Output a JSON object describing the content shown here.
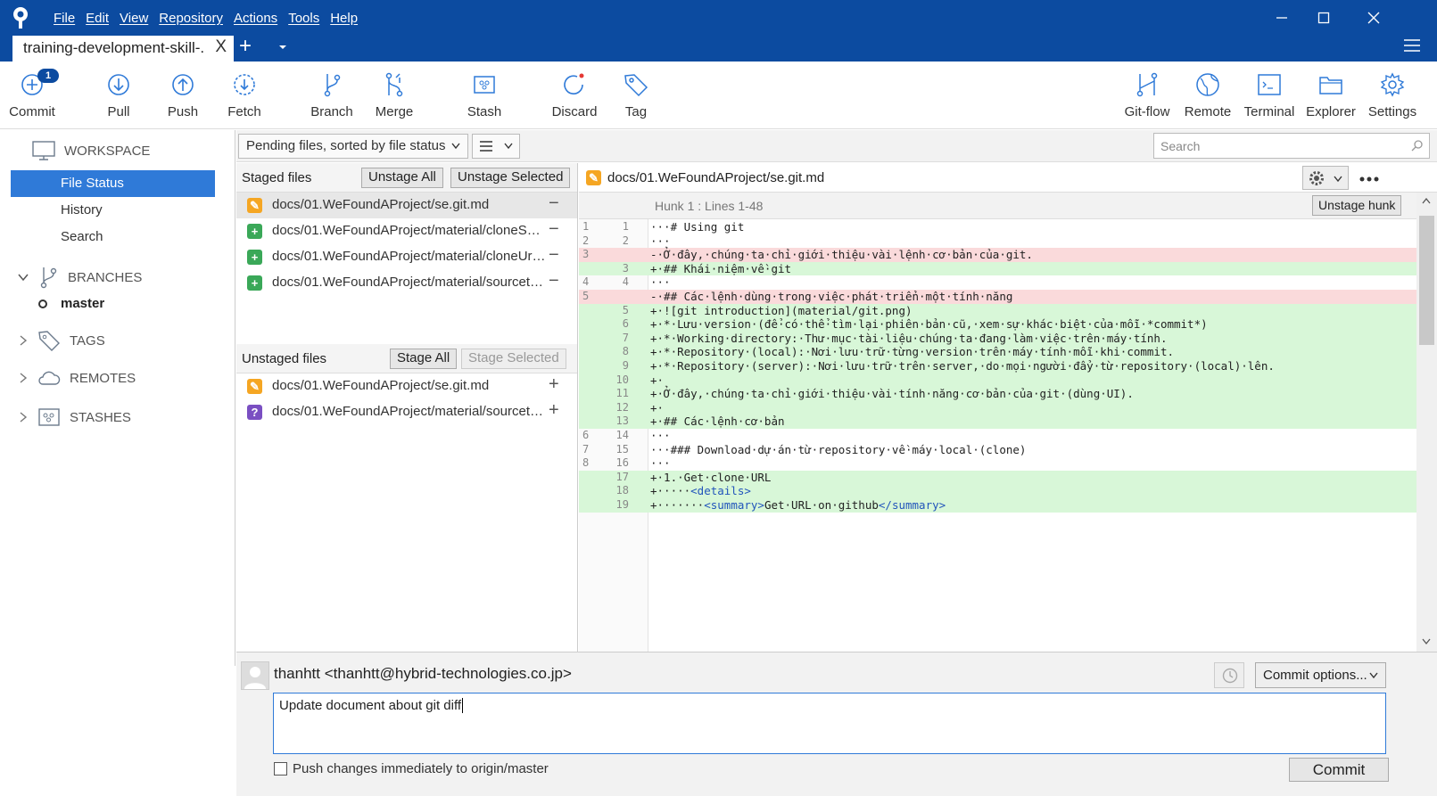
{
  "menu": [
    "File",
    "Edit",
    "View",
    "Repository",
    "Actions",
    "Tools",
    "Help"
  ],
  "tab": {
    "title": "training-development-skill-.",
    "close": "X"
  },
  "toolbar": {
    "commit": "Commit",
    "commit_badge": "1",
    "pull": "Pull",
    "push": "Push",
    "fetch": "Fetch",
    "branch": "Branch",
    "merge": "Merge",
    "stash": "Stash",
    "discard": "Discard",
    "tag": "Tag",
    "gitflow": "Git-flow",
    "remote": "Remote",
    "terminal": "Terminal",
    "explorer": "Explorer",
    "settings": "Settings"
  },
  "sidebar": {
    "workspace": "WORKSPACE",
    "file_status": "File Status",
    "history": "History",
    "search": "Search",
    "branches": "BRANCHES",
    "master": "master",
    "tags": "TAGS",
    "remotes": "REMOTES",
    "stashes": "STASHES"
  },
  "filter": {
    "sort": "Pending files, sorted by file status",
    "search_placeholder": "Search"
  },
  "staged": {
    "title": "Staged files",
    "unstage_all": "Unstage All",
    "unstage_selected": "Unstage Selected",
    "files": [
      {
        "name": "docs/01.WeFoundAProject/se.git.md",
        "status": "modified"
      },
      {
        "name": "docs/01.WeFoundAProject/material/cloneSam...",
        "status": "added"
      },
      {
        "name": "docs/01.WeFoundAProject/material/cloneUrl....",
        "status": "added"
      },
      {
        "name": "docs/01.WeFoundAProject/material/sourcetre...",
        "status": "added"
      }
    ]
  },
  "unstaged": {
    "title": "Unstaged files",
    "stage_all": "Stage All",
    "stage_selected": "Stage Selected",
    "files": [
      {
        "name": "docs/01.WeFoundAProject/se.git.md",
        "status": "modified"
      },
      {
        "name": "docs/01.WeFoundAProject/material/sourcetre...",
        "status": "untracked"
      }
    ]
  },
  "diff": {
    "path": "docs/01.WeFoundAProject/se.git.md",
    "hunk": "Hunk 1 : Lines 1-48",
    "unstage_hunk": "Unstage hunk",
    "lines": [
      {
        "o": "1",
        "n": "1",
        "type": "ctx",
        "text": "···# Using git"
      },
      {
        "o": "2",
        "n": "2",
        "type": "ctx",
        "text": "···"
      },
      {
        "o": "3",
        "n": "",
        "type": "del",
        "text": "-·Ở·đây,·chúng·ta·chỉ·giới·thiệu·vài·lệnh·cơ·bản·của·git."
      },
      {
        "o": "",
        "n": "3",
        "type": "add",
        "text": "+·## Khái·niệm·về·git"
      },
      {
        "o": "4",
        "n": "4",
        "type": "ctx",
        "text": "···"
      },
      {
        "o": "5",
        "n": "",
        "type": "del",
        "text": "-·## Các·lệnh·dùng·trong·việc·phát·triển·một·tính·năng"
      },
      {
        "o": "",
        "n": "5",
        "type": "add",
        "text": "+·![git introduction](material/git.png)"
      },
      {
        "o": "",
        "n": "6",
        "type": "add",
        "text": "+·*·Lưu·version·(để·có·thể·tìm·lại·phiên·bản·cũ,·xem·sự·khác·biệt·của·mỗi·*commit*)"
      },
      {
        "o": "",
        "n": "7",
        "type": "add",
        "text": "+·*·Working·directory:·Thư·mục·tài·liệu·chúng·ta·đang·làm·việc·trên·máy·tính."
      },
      {
        "o": "",
        "n": "8",
        "type": "add",
        "text": "+·*·Repository·(local):·Nơi·lưu·trữ·từng·version·trên·máy·tính·mỗi·khi·commit."
      },
      {
        "o": "",
        "n": "9",
        "type": "add",
        "text": "+·*·Repository·(server):·Nơi·lưu·trữ·trên·server,·do·mọi·người·đẩy·từ·repository·(local)·lên."
      },
      {
        "o": "",
        "n": "10",
        "type": "add",
        "text": "+·"
      },
      {
        "o": "",
        "n": "11",
        "type": "add",
        "text": "+·Ở·đây,·chúng·ta·chỉ·giới·thiệu·vài·tính·năng·cơ·bản·của·git·(dùng·UI)."
      },
      {
        "o": "",
        "n": "12",
        "type": "add",
        "text": "+·"
      },
      {
        "o": "",
        "n": "13",
        "type": "add",
        "text": "+·## Các·lệnh·cơ·bản"
      },
      {
        "o": "6",
        "n": "14",
        "type": "ctx",
        "text": "···"
      },
      {
        "o": "7",
        "n": "15",
        "type": "ctx",
        "text": "···### Download·dự·án·từ·repository·về·máy·local·(clone)"
      },
      {
        "o": "8",
        "n": "16",
        "type": "ctx",
        "text": "···"
      },
      {
        "o": "",
        "n": "17",
        "type": "add",
        "text": "+·1.·Get·clone·URL"
      },
      {
        "o": "",
        "n": "18",
        "type": "add",
        "text": "+·····<details>"
      },
      {
        "o": "",
        "n": "19",
        "type": "add",
        "text": "+·······<summary>Get·URL·on·github</summary>"
      }
    ]
  },
  "commit": {
    "author": "thanhtt <thanhtt@hybrid-technologies.co.jp>",
    "message": "Update document about git diff",
    "options": "Commit options...",
    "push_label": "Push changes immediately to origin/master",
    "button": "Commit"
  },
  "colors": {
    "brand": "#0c4ba0",
    "selection": "#2f7ad8",
    "added_bg": "#d8f7d8",
    "deleted_bg": "#fadadb"
  }
}
